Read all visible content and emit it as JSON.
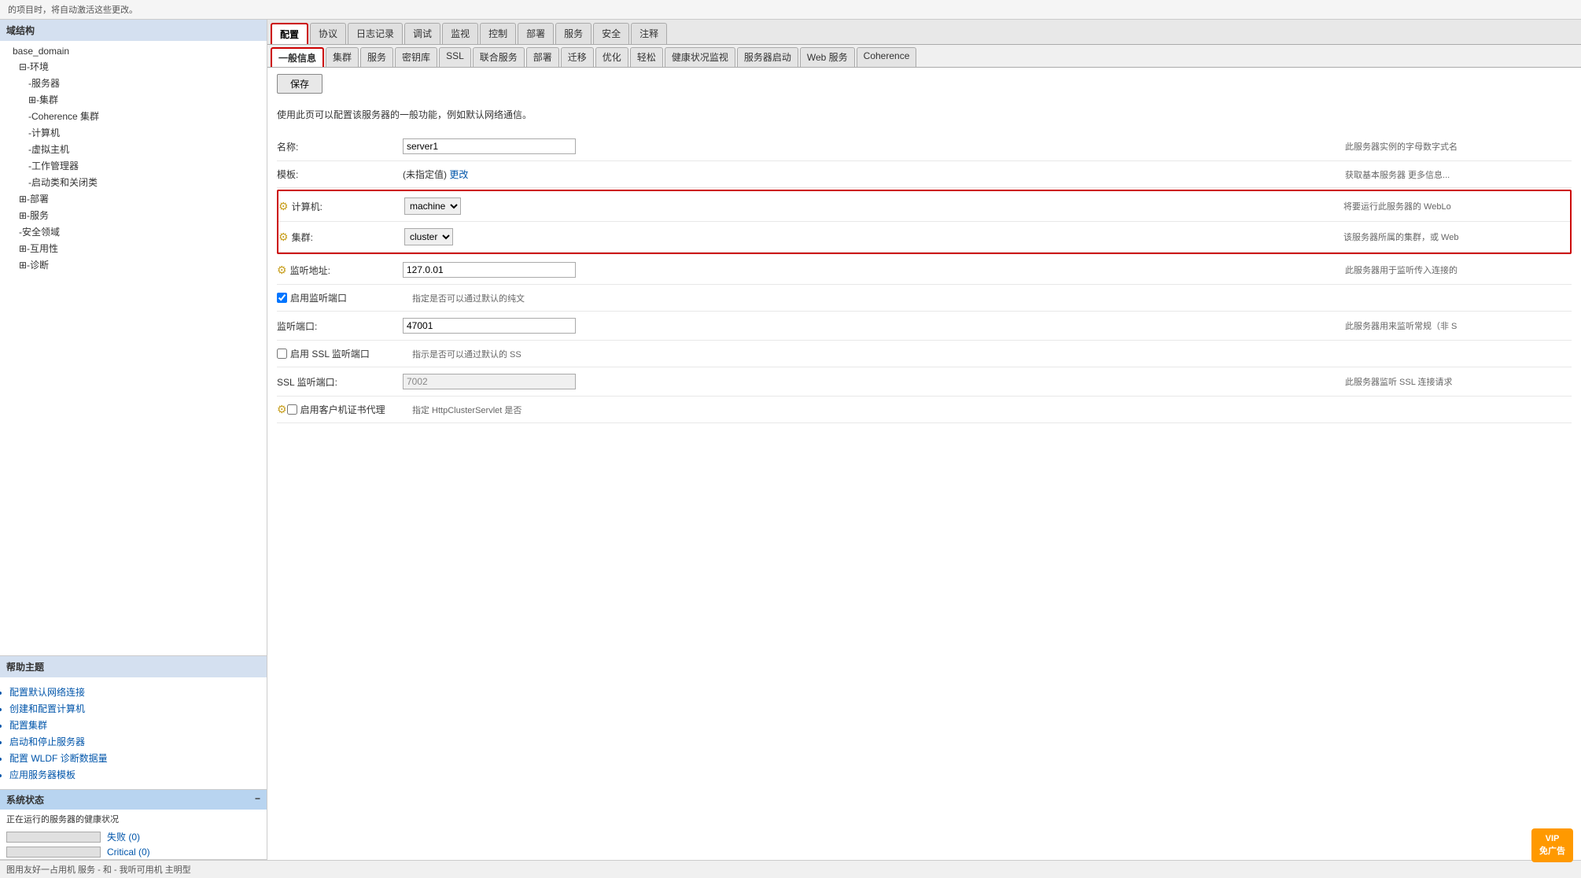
{
  "topBanner": {
    "text": "的项目时，将自动激活这些更改。"
  },
  "sidebar": {
    "domainStructureLabel": "域结构",
    "collapseIcon": "−",
    "treeItems": [
      {
        "label": "base_domain",
        "indent": 0,
        "icon": ""
      },
      {
        "label": "⊟-环境",
        "indent": 1,
        "icon": ""
      },
      {
        "label": "-服务器",
        "indent": 2,
        "icon": ""
      },
      {
        "label": "⊞-集群",
        "indent": 2,
        "icon": ""
      },
      {
        "label": "-Coherence 集群",
        "indent": 2,
        "icon": ""
      },
      {
        "label": "-计算机",
        "indent": 2,
        "icon": ""
      },
      {
        "label": "-虚拟主机",
        "indent": 2,
        "icon": ""
      },
      {
        "label": "-工作管理器",
        "indent": 2,
        "icon": ""
      },
      {
        "label": "-启动类和关闭类",
        "indent": 2,
        "icon": ""
      },
      {
        "label": "⊞-部署",
        "indent": 1,
        "icon": ""
      },
      {
        "label": "⊞-服务",
        "indent": 1,
        "icon": ""
      },
      {
        "label": "-安全领域",
        "indent": 1,
        "icon": ""
      },
      {
        "label": "⊞-互用性",
        "indent": 1,
        "icon": ""
      },
      {
        "label": "⊞-诊断",
        "indent": 1,
        "icon": ""
      }
    ]
  },
  "helpSection": {
    "label": "帮助主题",
    "items": [
      "配置默认网络连接",
      "创建和配置计算机",
      "配置集群",
      "启动和停止服务器",
      "配置 WLDF 诊断数据量",
      "应用服务器模板"
    ]
  },
  "statusSection": {
    "label": "系统状态",
    "collapseIcon": "−",
    "description": "正在运行的服务器的健康状况",
    "bars": [
      {
        "label": "失败 (0)",
        "value": 0,
        "color": "#cc0000"
      },
      {
        "label": "Critical (0)",
        "value": 0,
        "color": "#cc0000"
      }
    ]
  },
  "tabs1": {
    "items": [
      "配置",
      "协议",
      "日志记录",
      "调试",
      "监视",
      "控制",
      "部署",
      "服务",
      "安全",
      "注释"
    ],
    "active": "配置"
  },
  "tabs2": {
    "items": [
      "一般信息",
      "集群",
      "服务",
      "密钥库",
      "SSL",
      "联合服务",
      "部署",
      "迁移",
      "优化",
      "轻松",
      "健康状况监视",
      "服务器启动",
      "Web 服务",
      "Coherence"
    ],
    "active": "一般信息"
  },
  "saveButton": "保存",
  "infoText": "使用此页可以配置该服务器的一般功能，例如默认网络通信。",
  "formRows": [
    {
      "id": "name",
      "label": "名称:",
      "type": "text",
      "value": "server1",
      "disabled": false,
      "hint": "此服务器实例的字母数字式名",
      "hasIcon": false,
      "highlighted": false
    },
    {
      "id": "template",
      "label": "模板:",
      "type": "link",
      "value": "(未指定值)",
      "linkText": "更改",
      "hint": "获取基本服务器  更多信息...",
      "hasIcon": false,
      "highlighted": false
    },
    {
      "id": "machine",
      "label": "计算机:",
      "type": "select",
      "value": "machine",
      "options": [
        "machine"
      ],
      "hint": "将要运行此服务器的 WebLo",
      "hasIcon": true,
      "highlighted": true
    },
    {
      "id": "cluster",
      "label": "集群:",
      "type": "select",
      "value": "cluster",
      "options": [
        "cluster"
      ],
      "hint": "该服务器所属的集群，或 Web",
      "hasIcon": true,
      "highlighted": true
    },
    {
      "id": "listenAddress",
      "label": "监听地址:",
      "type": "text",
      "value": "127.0.01",
      "disabled": false,
      "hint": "此服务器用于监听传入连接的",
      "hasIcon": true,
      "highlighted": false
    },
    {
      "id": "enableListenPort",
      "label": "启用监听端口",
      "type": "checkbox",
      "checked": true,
      "hint": "指定是否可以通过默认的纯文",
      "hasIcon": false,
      "highlighted": false
    },
    {
      "id": "listenPort",
      "label": "监听端口:",
      "type": "text",
      "value": "47001",
      "disabled": false,
      "hint": "此服务器用来监听常规（非 S",
      "hasIcon": false,
      "highlighted": false
    },
    {
      "id": "enableSSL",
      "label": "启用 SSL 监听端口",
      "type": "checkbox",
      "checked": false,
      "hint": "指示是否可以通过默认的 SS",
      "hasIcon": false,
      "highlighted": false
    },
    {
      "id": "sslListenPort",
      "label": "SSL 监听端口:",
      "type": "text",
      "value": "7002",
      "disabled": true,
      "hint": "此服务器监听 SSL 连接请求",
      "hasIcon": false,
      "highlighted": false
    },
    {
      "id": "clientCertProxy",
      "label": "启用客户机证书代理",
      "type": "checkbox",
      "checked": false,
      "hint": "指定 HttpClusterServlet 是否",
      "hasIcon": true,
      "highlighted": false
    }
  ],
  "bottomBar": {
    "text": "图用友好一占用机 服务 - 和 - 我听可用机 主明型"
  },
  "vipBadge": {
    "line1": "VIP",
    "line2": "免广告"
  }
}
